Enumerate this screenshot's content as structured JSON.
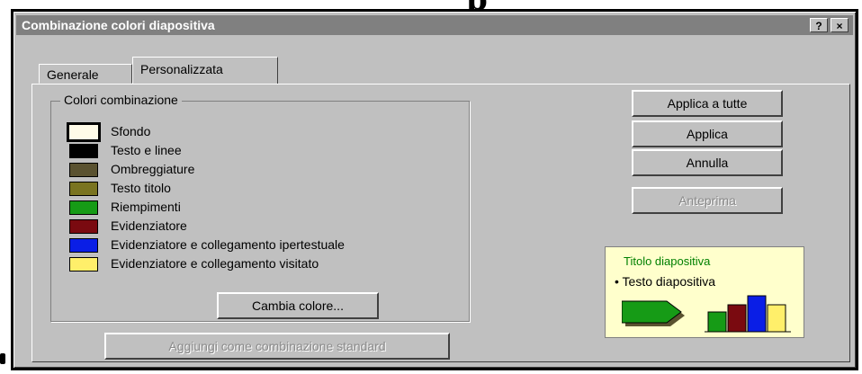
{
  "header_fragment": "p",
  "dialog": {
    "title": "Combinazione colori diapositiva",
    "help_button": "?",
    "close_button": "×"
  },
  "tabs": [
    {
      "label": "Generale",
      "active": false
    },
    {
      "label": "Personalizzata",
      "active": true
    }
  ],
  "color_group": {
    "title": "Colori combinazione",
    "items": [
      {
        "label": "Sfondo",
        "color": "#fffbe8",
        "selected": true
      },
      {
        "label": "Testo e linee",
        "color": "#000000"
      },
      {
        "label": "Ombreggiature",
        "color": "#5a5230"
      },
      {
        "label": "Testo titolo",
        "color": "#7a7420"
      },
      {
        "label": "Riempimenti",
        "color": "#169b16"
      },
      {
        "label": "Evidenziatore",
        "color": "#7a0a10"
      },
      {
        "label": "Evidenziatore e collegamento ipertestuale",
        "color": "#0a1ee6"
      },
      {
        "label": "Evidenziatore e collegamento visitato",
        "color": "#ffef6a"
      }
    ],
    "change_button": "Cambia colore..."
  },
  "buttons": {
    "apply_all": "Applica a tutte",
    "apply": "Applica",
    "cancel": "Annulla",
    "preview": "Anteprima",
    "add_standard": "Aggiungi come combinazione standard"
  },
  "preview": {
    "title": "Titolo diapositiva",
    "bullet": "• Testo diapositiva",
    "background": "#ffffcc",
    "bar_colors": [
      "#169b16",
      "#7a0a10",
      "#0a1ee6",
      "#ffef6a"
    ]
  }
}
